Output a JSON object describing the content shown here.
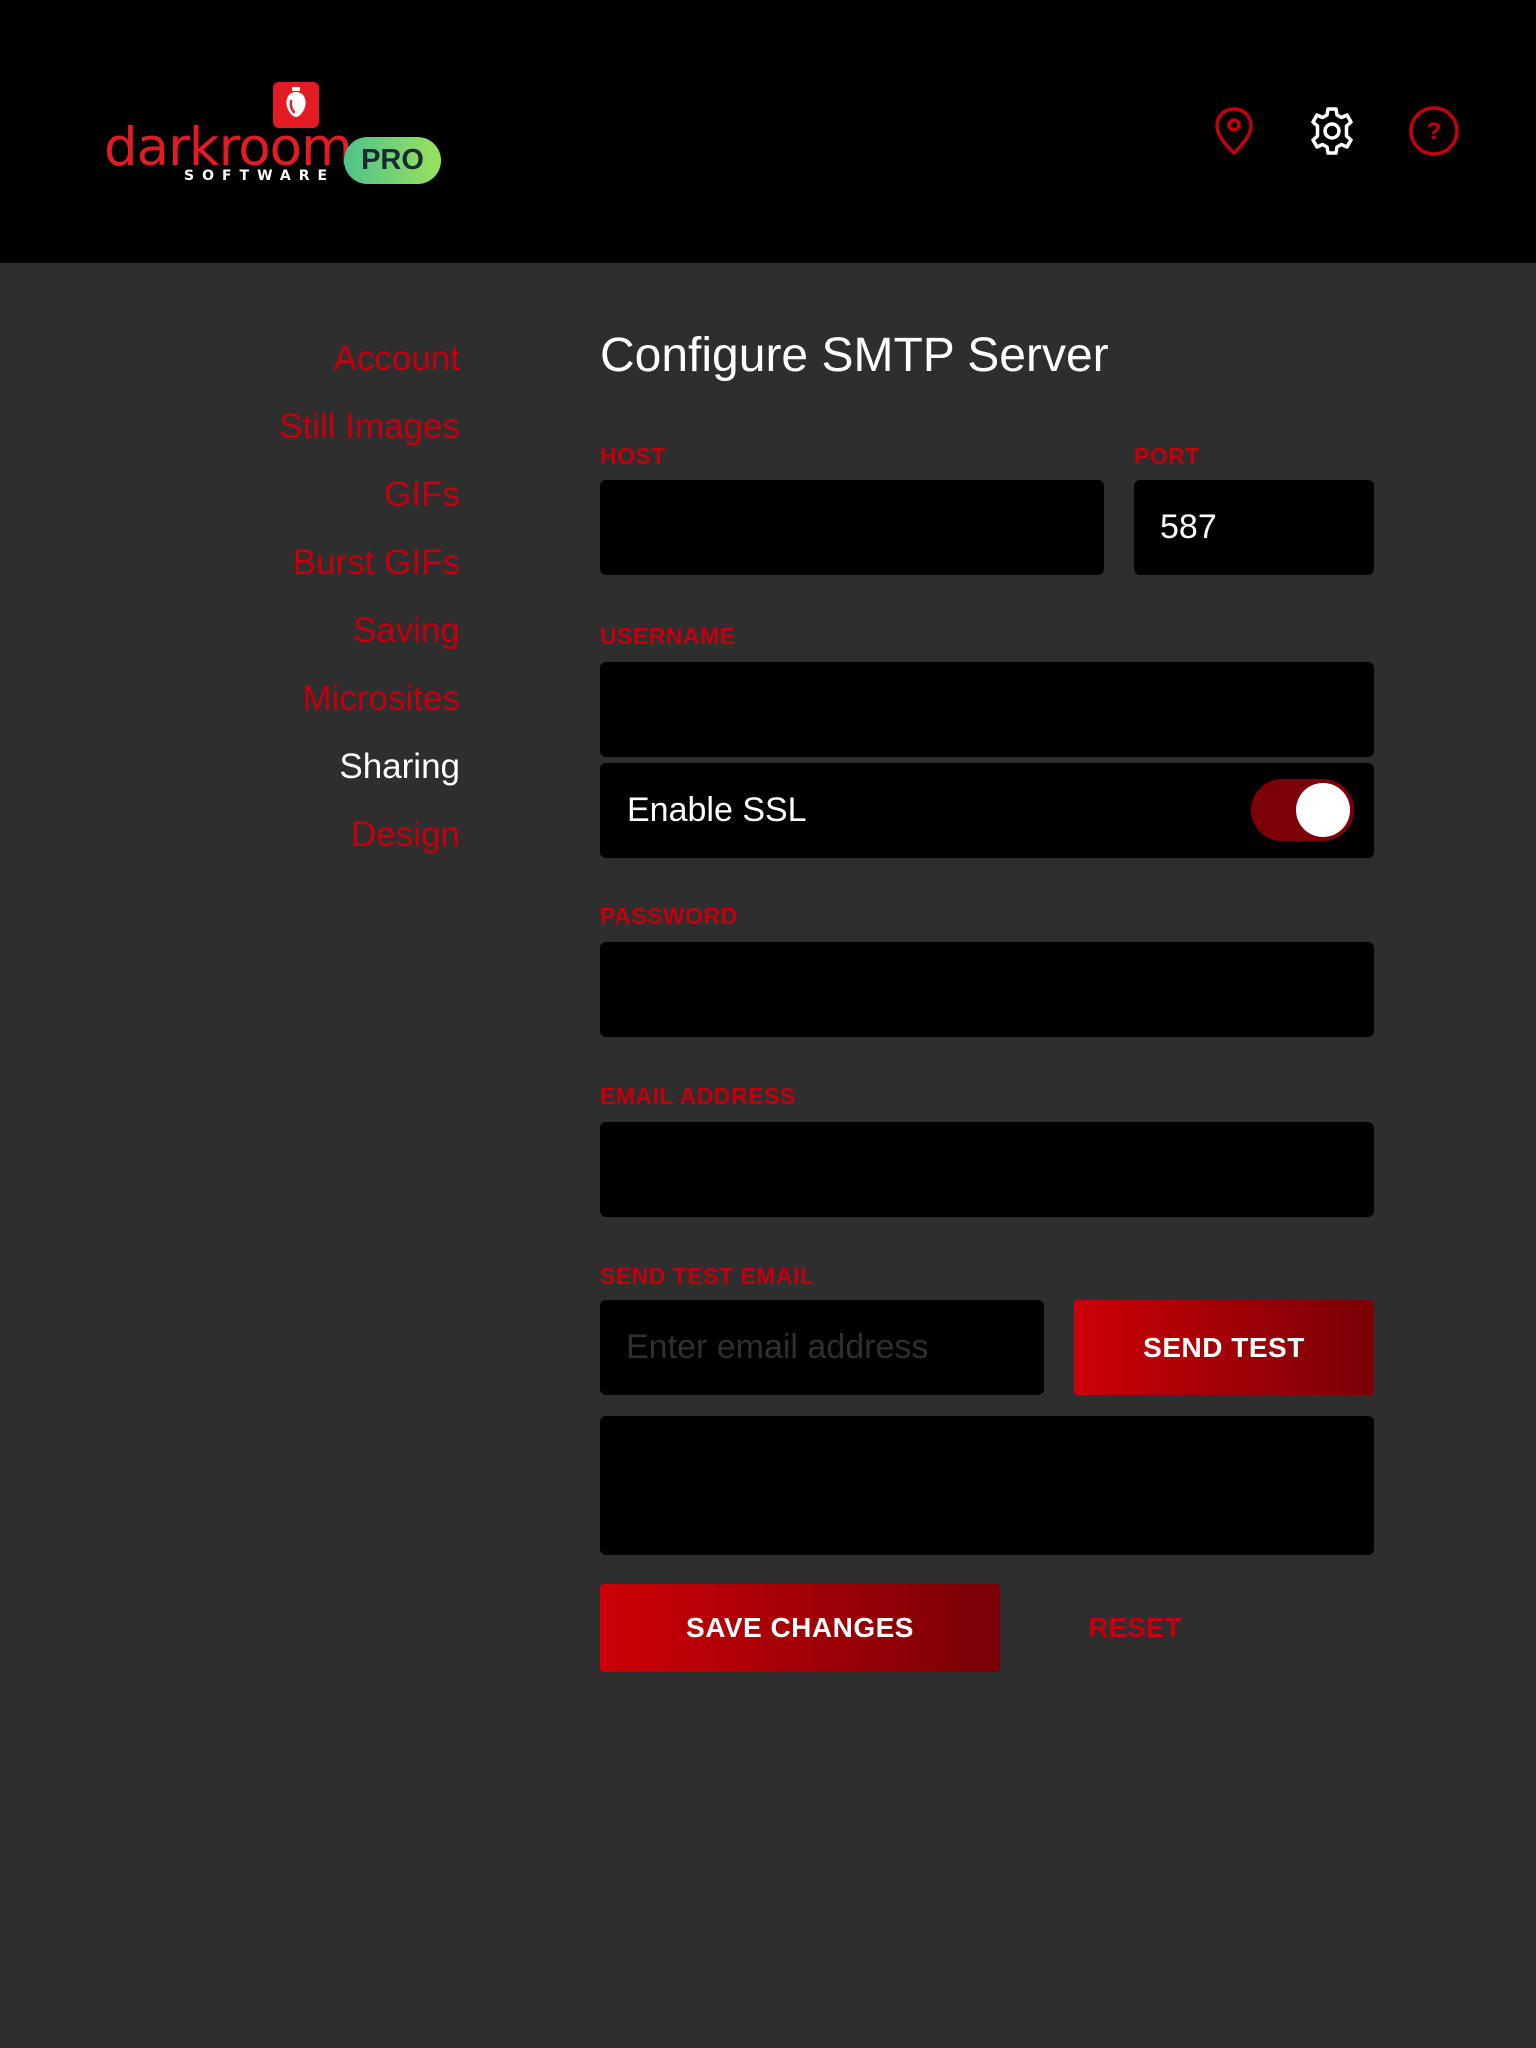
{
  "header": {
    "logo_wordmark": "darkroom",
    "logo_subtitle": "SOFTWARE",
    "badge": "PRO",
    "icons": [
      "location-pin-icon",
      "gear-icon",
      "help-icon"
    ]
  },
  "nav": {
    "items": [
      {
        "label": "Account",
        "active": false
      },
      {
        "label": "Still Images",
        "active": false
      },
      {
        "label": "GIFs",
        "active": false
      },
      {
        "label": "Burst GIFs",
        "active": false
      },
      {
        "label": "Saving",
        "active": false
      },
      {
        "label": "Microsites",
        "active": false
      },
      {
        "label": "Sharing",
        "active": true
      },
      {
        "label": "Design",
        "active": false
      }
    ]
  },
  "main": {
    "title": "Configure SMTP Server",
    "host": {
      "label": "HOST",
      "value": ""
    },
    "port": {
      "label": "PORT",
      "value": "587"
    },
    "username": {
      "label": "USERNAME",
      "value": ""
    },
    "ssl": {
      "label": "Enable SSL",
      "enabled": true
    },
    "password": {
      "label": "PASSWORD",
      "value": ""
    },
    "email": {
      "label": "EMAIL ADDRESS",
      "value": ""
    },
    "test": {
      "label": "SEND TEST EMAIL",
      "placeholder": "Enter email address",
      "button": "SEND TEST"
    },
    "save_label": "SAVE CHANGES",
    "reset_label": "RESET"
  },
  "colors": {
    "accent": "#c4000e",
    "brand_red": "#e31b23",
    "background": "#2e2e2e",
    "header_bg": "#000000",
    "field_bg": "#000000",
    "pro_badge_start": "#4cc38a",
    "pro_badge_end": "#9be15d"
  }
}
